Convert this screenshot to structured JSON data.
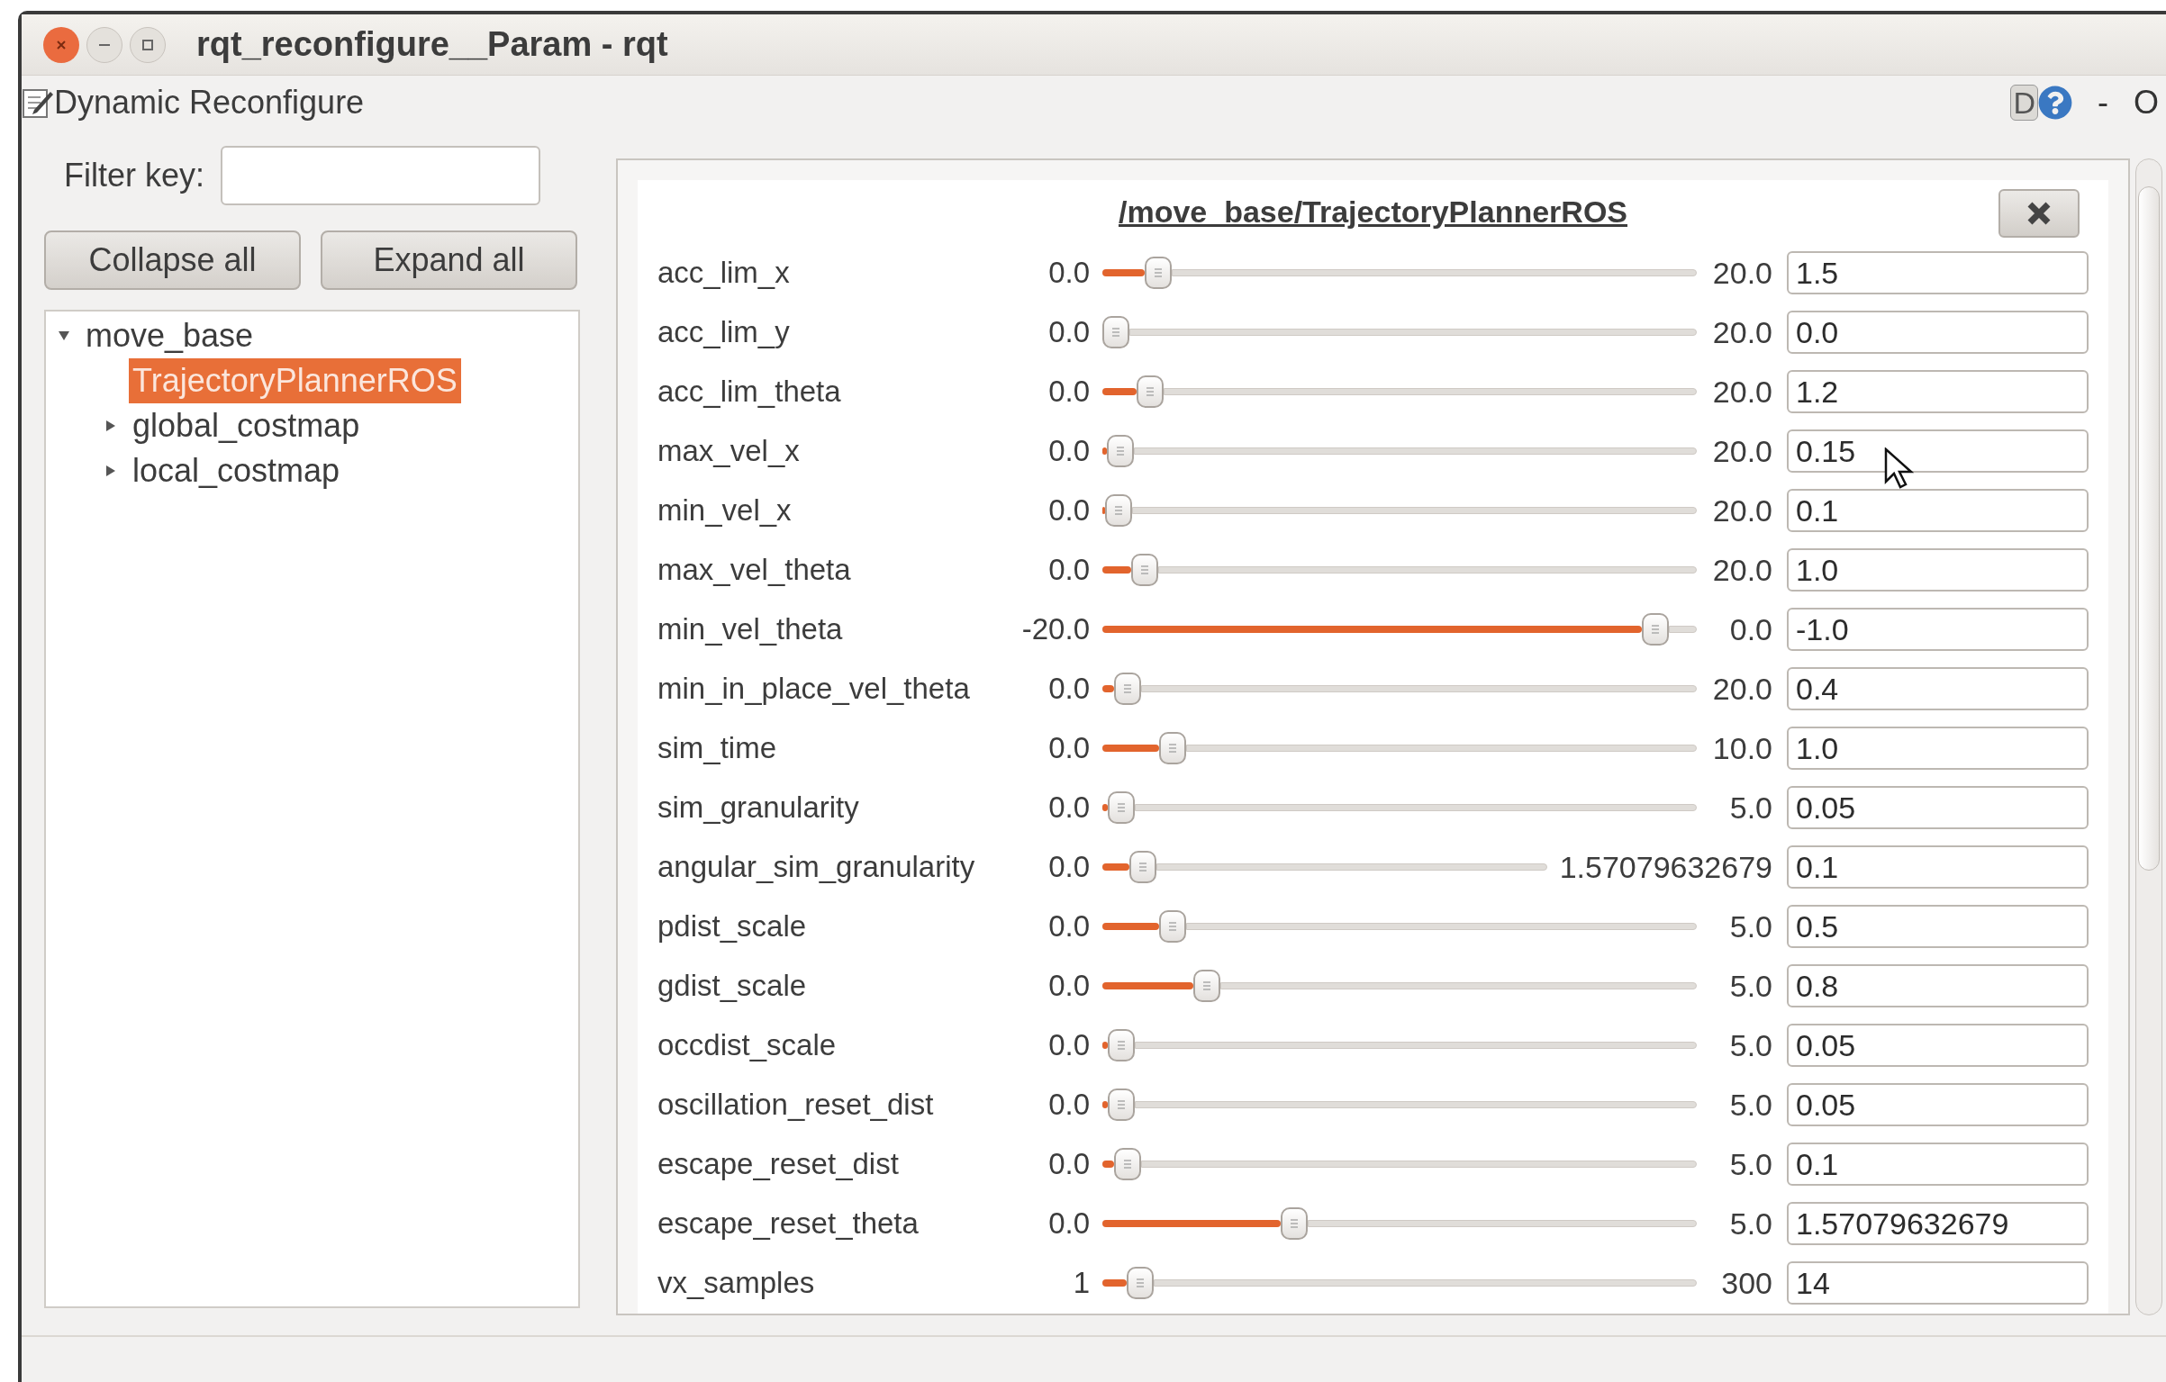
{
  "window": {
    "title": "rqt_reconfigure__Param - rqt"
  },
  "plugin": {
    "title": "Dynamic Reconfigure",
    "badge": "D",
    "controls": [
      "-",
      "O"
    ]
  },
  "filter": {
    "label": "Filter key:"
  },
  "buttons": [
    "Collapse all",
    "Expand all"
  ],
  "tree": [
    {
      "label": "move_base",
      "expanded": true,
      "selected": false,
      "children": [
        {
          "label": "TrajectoryPlannerROS",
          "selected": true
        },
        {
          "label": "global_costmap",
          "selected": false,
          "expanded": false
        },
        {
          "label": "local_costmap",
          "selected": false,
          "expanded": false
        }
      ]
    }
  ],
  "group": {
    "title": "/move_base/TrajectoryPlannerROS",
    "params": [
      {
        "name": "acc_lim_x",
        "min": "0.0",
        "max": "20.0",
        "level": 0.075,
        "value": "1.5"
      },
      {
        "name": "acc_lim_y",
        "min": "0.0",
        "max": "20.0",
        "level": 0.0,
        "value": "0.0"
      },
      {
        "name": "acc_lim_theta",
        "min": "0.0",
        "max": "20.0",
        "level": 0.06,
        "value": "1.2"
      },
      {
        "name": "max_vel_x",
        "min": "0.0",
        "max": "20.0",
        "level": 0.0075,
        "value": "0.15"
      },
      {
        "name": "min_vel_x",
        "min": "0.0",
        "max": "20.0",
        "level": 0.005,
        "value": "0.1"
      },
      {
        "name": "max_vel_theta",
        "min": "0.0",
        "max": "20.0",
        "level": 0.05,
        "value": "1.0"
      },
      {
        "name": "min_vel_theta",
        "min": "-20.0",
        "max": "0.0",
        "level": 0.95,
        "value": "-1.0"
      },
      {
        "name": "min_in_place_vel_theta",
        "min": "0.0",
        "max": "20.0",
        "level": 0.02,
        "value": "0.4"
      },
      {
        "name": "sim_time",
        "min": "0.0",
        "max": "10.0",
        "level": 0.1,
        "value": "1.0"
      },
      {
        "name": "sim_granularity",
        "min": "0.0",
        "max": "5.0",
        "level": 0.01,
        "value": "0.05"
      },
      {
        "name": "angular_sim_granularity",
        "min": "0.0",
        "max": "1.57079632679",
        "level": 0.064,
        "value": "0.1"
      },
      {
        "name": "pdist_scale",
        "min": "0.0",
        "max": "5.0",
        "level": 0.1,
        "value": "0.5"
      },
      {
        "name": "gdist_scale",
        "min": "0.0",
        "max": "5.0",
        "level": 0.16,
        "value": "0.8"
      },
      {
        "name": "occdist_scale",
        "min": "0.0",
        "max": "5.0",
        "level": 0.01,
        "value": "0.05"
      },
      {
        "name": "oscillation_reset_dist",
        "min": "0.0",
        "max": "5.0",
        "level": 0.01,
        "value": "0.05"
      },
      {
        "name": "escape_reset_dist",
        "min": "0.0",
        "max": "5.0",
        "level": 0.02,
        "value": "0.1"
      },
      {
        "name": "escape_reset_theta",
        "min": "0.0",
        "max": "5.0",
        "level": 0.314,
        "value": "1.57079632679"
      },
      {
        "name": "vx_samples",
        "min": "1",
        "max": "300",
        "level": 0.043,
        "value": "14"
      }
    ]
  }
}
